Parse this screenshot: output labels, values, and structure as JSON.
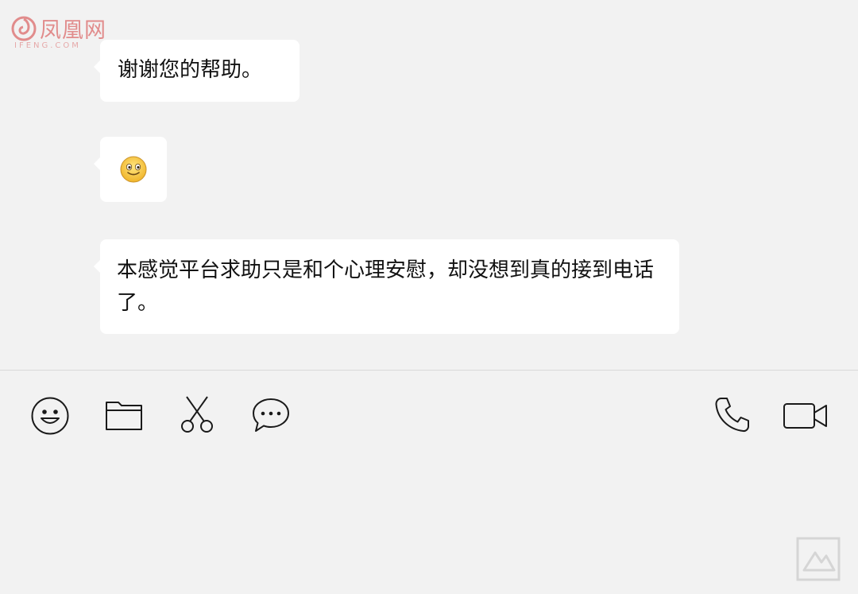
{
  "watermark": {
    "brand": "凤凰网",
    "brand_latin": "IFENG.COM"
  },
  "messages": [
    {
      "type": "text",
      "text": "谢谢您的帮助。"
    },
    {
      "type": "emoji",
      "emoji": "smiley-face-icon"
    },
    {
      "type": "text",
      "text": "本感觉平台求助只是和个心理安慰，却没想到真的接到电话了。"
    }
  ],
  "toolbar": {
    "left": [
      "emoji-icon",
      "folder-icon",
      "scissors-icon",
      "chat-bubble-icon"
    ],
    "right": [
      "phone-icon",
      "video-camera-icon"
    ]
  },
  "colors": {
    "background": "#f2f2f2",
    "bubble": "#ffffff",
    "text": "#111111",
    "icon_stroke": "#1a1a1a",
    "logo_red": "#d43a3a"
  }
}
